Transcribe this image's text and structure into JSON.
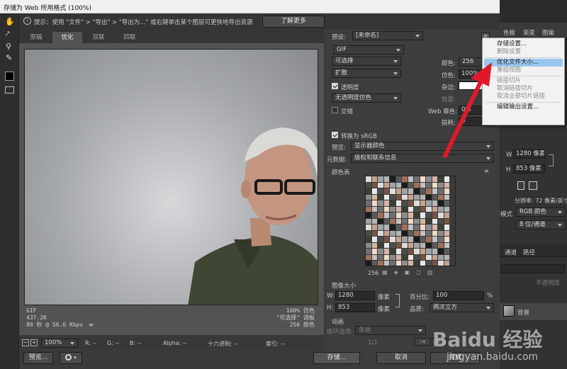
{
  "window": {
    "title": "存储为 Web 所用格式 (100%)"
  },
  "hint": {
    "text": "提示：使用 \"文件\" > \"导出\" > \"导出为...\" 或右键单击某个图层可更快地导出资源",
    "learn_more": "了解更多"
  },
  "tabs": [
    "原稿",
    "优化",
    "双联",
    "四联"
  ],
  "active_tab": "优化",
  "settings": {
    "preset_label": "预设:",
    "preset_value": "[未命名]",
    "format": "GIF",
    "reduction": "可选择",
    "dither_algo": "扩散",
    "transparency_label": "透明度",
    "transparency_dither": "无透明度仿色",
    "interlaced_label": "交错",
    "colors_label": "颜色:",
    "colors_value": "256",
    "dither_label": "仿色:",
    "dither_value": "100%",
    "matte_label": "杂边:",
    "amount_label": "数量:",
    "web_snap_label": "Web 靠色:",
    "web_snap_value": "0%",
    "lossy_label": "损耗:",
    "lossy_value": "0",
    "convert_srgb_label": "转换为 sRGB",
    "preview_label": "预览:",
    "preview_value": "显示器颜色",
    "metadata_label": "元数据:",
    "metadata_value": "版权和联系信息",
    "color_table_label": "颜色表",
    "color_count": "256"
  },
  "context_menu": {
    "items": [
      {
        "label": "存储设置...",
        "state": "normal"
      },
      {
        "label": "删除设置",
        "state": "disabled"
      },
      {
        "sep": true
      },
      {
        "label": "优化文件大小...",
        "state": "highlighted"
      },
      {
        "label": "重组视图",
        "state": "disabled"
      },
      {
        "sep": true
      },
      {
        "label": "链接切片",
        "state": "disabled"
      },
      {
        "label": "取消链接切片",
        "state": "disabled"
      },
      {
        "label": "取消全部切片链接",
        "state": "disabled"
      },
      {
        "sep": true
      },
      {
        "label": "编辑输出设置...",
        "state": "normal"
      }
    ]
  },
  "image_size": {
    "header": "图像大小",
    "w_label": "W:",
    "w_value": "1280",
    "h_label": "H:",
    "h_value": "853",
    "unit": "像素",
    "percent_label": "百分比:",
    "percent_value": "100",
    "percent_unit": "%",
    "quality_label": "品质:",
    "quality_value": "两次立方"
  },
  "animation": {
    "header": "动画",
    "loop_label": "循环选项:",
    "loop_value": "永远",
    "frame": "1/1"
  },
  "preview_info": {
    "format": "GIF",
    "size": "437.2K",
    "time": "80 秒 @ 56.6 Kbps",
    "dither": "100% 仿色",
    "palette": "\"可选择\" 调板",
    "colors": "256 颜色"
  },
  "status": {
    "zoom": "100%",
    "r": "R: --",
    "g": "G: --",
    "b": "B: --",
    "alpha": "Alpha: --",
    "hex": "十六进制: --",
    "index": "索引: --"
  },
  "buttons": {
    "preview": "预览...",
    "save": "存储...",
    "cancel": "取消",
    "done": "完成"
  },
  "bg_panel": {
    "tabs": [
      "色板",
      "渐变",
      "图案"
    ],
    "w_label": "W",
    "w_value": "1280 像素",
    "h_label": "H",
    "h_value": "853 像素",
    "resolution": "分辨率: 72 像素/英寸",
    "mode_label": "模式",
    "mode_value": "RGB 颜色",
    "depth_value": "8 位/通道",
    "channel_tabs": [
      "通道",
      "路径"
    ],
    "opacity": "不透明度",
    "layer_name": "背景"
  },
  "watermark": {
    "text": "Baidu 经验",
    "url": "jingyan.baidu.com"
  },
  "colors": {
    "accent_red": "#e0192a",
    "menu_highlight": "#99c6ee"
  }
}
